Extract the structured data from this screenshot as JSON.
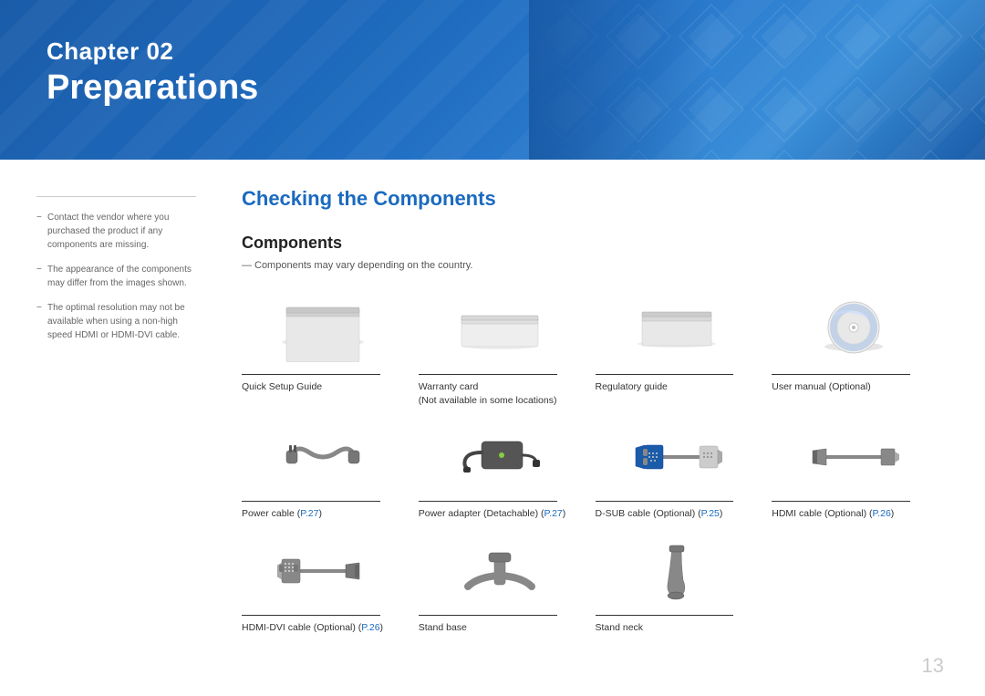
{
  "header": {
    "chapter_label": "Chapter  02",
    "chapter_title": "Preparations",
    "background_color": "#1a5ca8"
  },
  "sidebar": {
    "notes": [
      "Contact the vendor where you purchased the product if any components are missing.",
      "The appearance of the components may differ from the images shown.",
      "The optimal resolution may not be available when using a non-high speed HDMI or HDMI-DVI cable."
    ]
  },
  "main": {
    "section_title": "Checking the Components",
    "subsection_title": "Components",
    "components_note": "Components may vary depending on the country.",
    "components": [
      {
        "label": "Quick Setup Guide",
        "type": "booklet-flat"
      },
      {
        "label": "Warranty card\n(Not available in some locations)",
        "type": "card-flat"
      },
      {
        "label": "Regulatory guide",
        "type": "booklet-thin"
      },
      {
        "label": "User manual (Optional)",
        "type": "cd-disc"
      },
      {
        "label": "Power cable",
        "link_text": "P.27",
        "link_ref": "P.27",
        "type": "power-cable"
      },
      {
        "label": "Power adapter (Detachable)",
        "link_text": "P.27",
        "link_ref": "P.27",
        "type": "power-adapter"
      },
      {
        "label": "D-SUB cable (Optional)",
        "link_text": "P.25",
        "link_ref": "P.25",
        "type": "dsub-cable"
      },
      {
        "label": "HDMI cable (Optional)",
        "link_text": "P.26",
        "link_ref": "P.26",
        "type": "hdmi-cable"
      },
      {
        "label": "HDMI-DVI cable (Optional)",
        "link_text": "P.26",
        "link_ref": "P.26",
        "type": "hdmi-dvi-cable"
      },
      {
        "label": "Stand base",
        "type": "stand-base"
      },
      {
        "label": "Stand neck",
        "type": "stand-neck"
      }
    ]
  },
  "page_number": "13"
}
